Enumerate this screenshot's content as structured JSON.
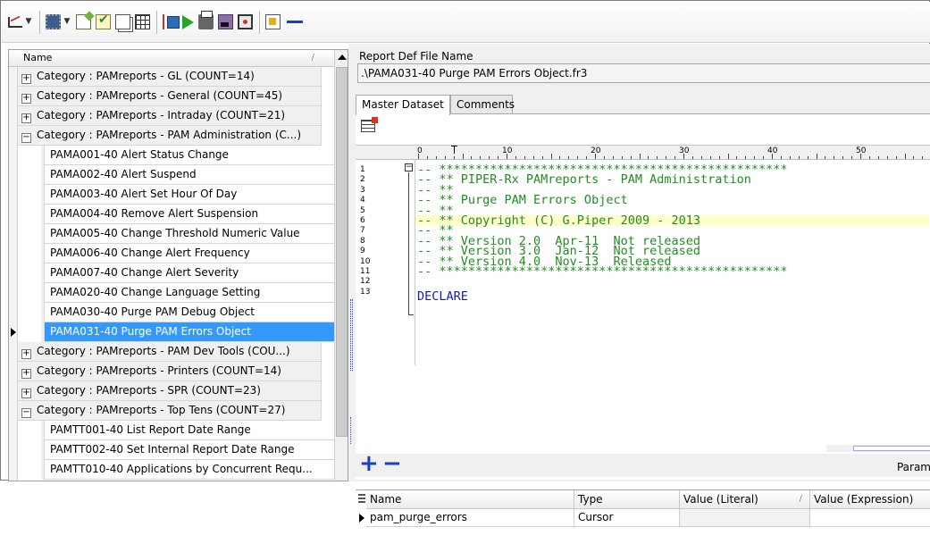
{
  "toolbar": {
    "icons": [
      "trend-icon",
      "chip-icon",
      "edit-note-icon",
      "approve-icon",
      "copy-icon",
      "grid-icon",
      "tree-icon",
      "run-icon",
      "print-icon",
      "calculator-icon",
      "capture-icon",
      "page-icon",
      "minus-icon"
    ]
  },
  "tree": {
    "header_label": "Name",
    "rows": [
      {
        "kind": "category",
        "toggle": "+",
        "label": "Category : PAMreports - GL (COUNT=14)"
      },
      {
        "kind": "category",
        "toggle": "+",
        "label": "Category : PAMreports - General (COUNT=45)"
      },
      {
        "kind": "category",
        "toggle": "+",
        "label": "Category : PAMreports - Intraday (COUNT=21)"
      },
      {
        "kind": "category",
        "toggle": "−",
        "label": "Category : PAMreports - PAM Administration (C...)"
      },
      {
        "kind": "item",
        "label": "PAMA001-40 Alert Status Change"
      },
      {
        "kind": "item",
        "label": "PAMA002-40 Alert Suspend"
      },
      {
        "kind": "item",
        "label": "PAMA003-40 Alert Set Hour Of Day"
      },
      {
        "kind": "item",
        "label": "PAMA004-40 Remove Alert Suspension"
      },
      {
        "kind": "item",
        "label": "PAMA005-40 Change Threshold Numeric Value"
      },
      {
        "kind": "item",
        "label": "PAMA006-40 Change Alert Frequency"
      },
      {
        "kind": "item",
        "label": "PAMA007-40 Change Alert Severity"
      },
      {
        "kind": "item",
        "label": "PAMA020-40 Change Language Setting"
      },
      {
        "kind": "item",
        "label": "PAMA030-40 Purge PAM Debug Object"
      },
      {
        "kind": "item",
        "label": "PAMA031-40 Purge PAM Errors Object",
        "selected": true
      },
      {
        "kind": "category",
        "toggle": "+",
        "label": "Category : PAMreports - PAM Dev Tools (COU...)"
      },
      {
        "kind": "category",
        "toggle": "+",
        "label": "Category : PAMreports - Printers (COUNT=14)"
      },
      {
        "kind": "category",
        "toggle": "+",
        "label": "Category : PAMreports - SPR (COUNT=23)"
      },
      {
        "kind": "category",
        "toggle": "−",
        "label": "Category : PAMreports - Top Tens (COUNT=27)"
      },
      {
        "kind": "item",
        "label": "PAMTT001-40 List Report Date Range"
      },
      {
        "kind": "item",
        "label": "PAMTT002-40 Set Internal Report Date Range"
      },
      {
        "kind": "item",
        "label": "PAMTT010-40 Applications by Concurrent Requ..."
      }
    ]
  },
  "report": {
    "file_label": "Report Def File Name",
    "file_value": ".\\PAMA031-40 Purge PAM Errors Object.fr3"
  },
  "tabs": [
    "Master Dataset",
    "Comments"
  ],
  "ruler": {
    "numbers": [
      "10",
      "20",
      "30",
      "40",
      "50"
    ]
  },
  "code": {
    "lines": [
      {
        "n": "1",
        "text": "-- ************************************************"
      },
      {
        "n": "2",
        "text": "-- ** PIPER-Rx PAMreports - PAM Administration"
      },
      {
        "n": "3",
        "text": "-- **"
      },
      {
        "n": "4",
        "text": "-- ** Purge PAM Errors Object"
      },
      {
        "n": "5",
        "text": "-- **"
      },
      {
        "n": "6",
        "text": "-- ** Copyright (C) G.Piper 2009 - 2013",
        "highlight": true
      },
      {
        "n": "7",
        "text": "-- **"
      },
      {
        "n": "8",
        "text": "-- ** Version 2.0  Apr-11  Not released"
      },
      {
        "n": "9",
        "text": "-- ** Version 3.0  Jan-12  Not released"
      },
      {
        "n": "10",
        "text": "-- ** Version 4.0  Nov-13  Released"
      },
      {
        "n": "11",
        "text": "-- ************************************************"
      },
      {
        "n": "12",
        "text": ""
      },
      {
        "n": "13",
        "text": "DECLARE",
        "keyword": true
      }
    ]
  },
  "params": {
    "label": "Param",
    "columns": [
      "Name",
      "Type",
      "Value (Literal)",
      "Value (Expression)"
    ],
    "rows": [
      {
        "name": "pam_purge_errors",
        "type": "Cursor",
        "literal": "",
        "expression": ""
      }
    ]
  }
}
